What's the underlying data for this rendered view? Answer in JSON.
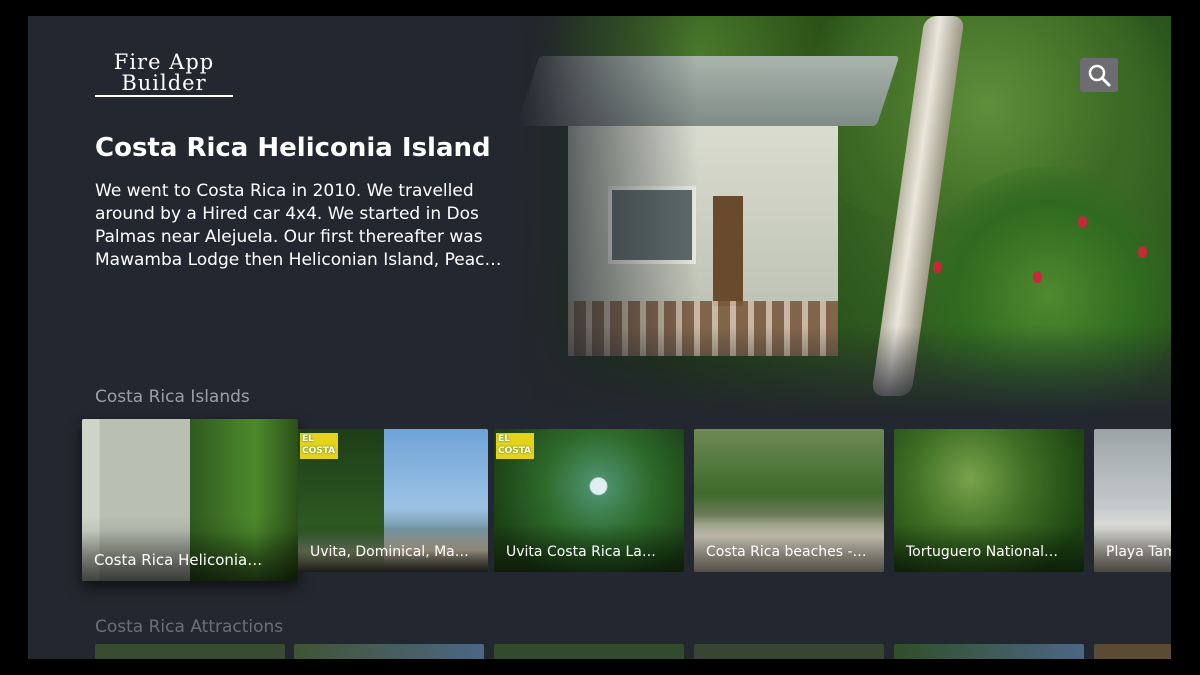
{
  "app": {
    "logo_line1": "Fire App",
    "logo_line2": "Builder"
  },
  "header": {
    "search_icon": "search-icon"
  },
  "featured": {
    "title": "Costa Rica Heliconia Island",
    "description": "We went to Costa Rica in 2010. We travelled around by a Hired car 4x4. We started in Dos Palmas near Alejuela. Our first thereafter was Mawamba Lodge then Heliconian Island, Peac…"
  },
  "rows": [
    {
      "title": "Costa Rica Islands",
      "items": [
        {
          "label": "Costa Rica Heliconia…"
        },
        {
          "label": "Uvita, Dominical, Manu…",
          "badge": "EL COSTA NOW"
        },
        {
          "label": "Uvita Costa Rica La…",
          "badge": "EL COSTA NOW"
        },
        {
          "label": "Costa Rica beaches -…"
        },
        {
          "label": "Tortuguero National…"
        },
        {
          "label": "Playa Tam"
        }
      ]
    },
    {
      "title": "Costa Rica Attractions",
      "items": [
        {},
        {},
        {},
        {},
        {},
        {}
      ]
    }
  ],
  "colors": {
    "background": "#23272f",
    "row_title": "#9aa0a8",
    "search_button": "#6c6c72"
  }
}
